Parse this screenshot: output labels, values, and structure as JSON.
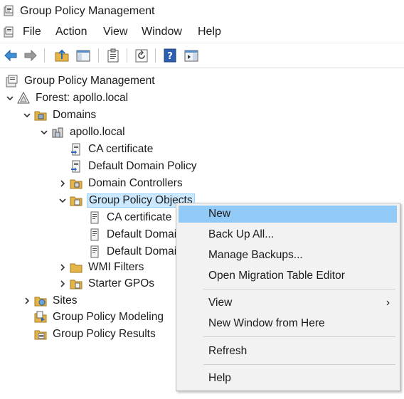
{
  "window": {
    "title": "Group Policy Management"
  },
  "menu": [
    "File",
    "Action",
    "View",
    "Window",
    "Help"
  ],
  "toolbar": {
    "buttons": [
      "back-icon",
      "forward-icon",
      "up-folder-icon",
      "show-hide-console-tree-icon",
      "properties-icon",
      "refresh-icon",
      "help-icon",
      "action-pane-icon"
    ]
  },
  "tree": {
    "root": "Group Policy Management",
    "forest": "Forest: apollo.local",
    "domains": "Domains",
    "domain": "apollo.local",
    "domain_children": [
      "CA certificate",
      "Default Domain Policy",
      "Domain Controllers",
      "Group Policy Objects"
    ],
    "gpos": [
      "CA certificate",
      "Default Domain Policy",
      "Default Domain Controllers Policy"
    ],
    "after_gpos": [
      "WMI Filters",
      "Starter GPOs"
    ],
    "top_level": [
      "Sites",
      "Group Policy Modeling",
      "Group Policy Results"
    ]
  },
  "context_menu": {
    "items": [
      "New",
      "Back Up All...",
      "Manage Backups...",
      "Open Migration Table Editor",
      "View",
      "New Window from Here",
      "Refresh",
      "Help"
    ],
    "submenu_arrow": "›",
    "highlighted": "New"
  }
}
